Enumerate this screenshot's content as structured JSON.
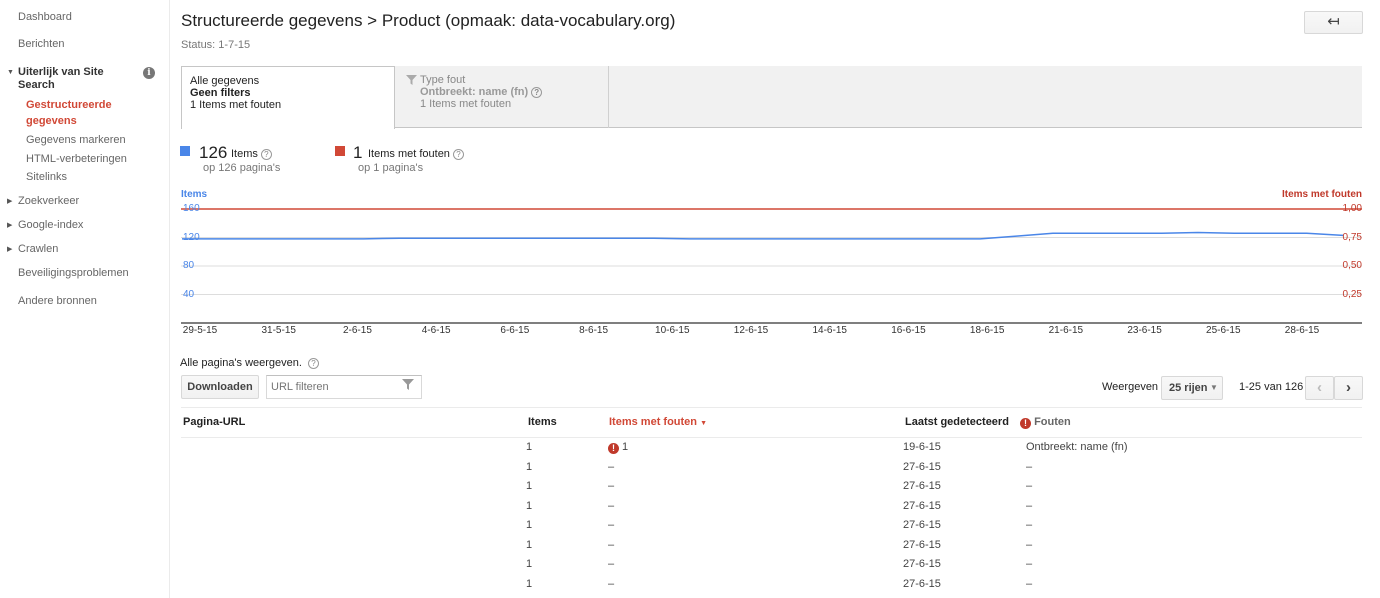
{
  "sidebar": {
    "dashboard": "Dashboard",
    "berichten": "Berichten",
    "uiterlijk": "Uiterlijk van Site Search",
    "sub": [
      "Gestructureerde gegevens",
      "Gegevens markeren",
      "HTML-verbeteringen",
      "Sitelinks"
    ],
    "zoekverkeer": "Zoekverkeer",
    "google_index": "Google-index",
    "crawlen": "Crawlen",
    "beveiliging": "Beveiligingsproblemen",
    "andere": "Andere bronnen"
  },
  "header": {
    "title": "Structureerde gegevens > Product (opmaak: data-vocabulary.org)",
    "status": "Status: 1-7-15",
    "back_glyph": "↤"
  },
  "tabs": {
    "active": {
      "line1": "Alle gegevens",
      "line2": "Geen filters",
      "line3": "1 Items met fouten"
    },
    "second": {
      "line1": "Type fout",
      "line2": "Ontbreekt: name (fn)",
      "line3": "1 Items met fouten"
    }
  },
  "legend": {
    "items": {
      "count": "126",
      "label": "Items",
      "sub": "op 126 pagina's",
      "color": "#4a86e8"
    },
    "errors": {
      "count": "1",
      "label": "Items met fouten",
      "sub": "op 1 pagina's",
      "color": "#d14836"
    }
  },
  "chart_data": {
    "type": "line",
    "ylabel": "Items",
    "ylabel_right": "Items met fouten",
    "y_ticks_left": [
      "160",
      "120",
      "80",
      "40"
    ],
    "y_ticks_right": [
      "1,00",
      "0,75",
      "0,50",
      "0,25"
    ],
    "ylim": [
      0,
      160
    ],
    "ylim_right": [
      0,
      1
    ],
    "x_ticks": [
      "29-5-15",
      "31-5-15",
      "2-6-15",
      "4-6-15",
      "6-6-15",
      "8-6-15",
      "10-6-15",
      "12-6-15",
      "14-6-15",
      "16-6-15",
      "18-6-15",
      "21-6-15",
      "23-6-15",
      "25-6-15",
      "28-6-15"
    ],
    "series": [
      {
        "name": "Items",
        "color": "#4a86e8",
        "values": [
          118,
          118,
          118,
          118,
          118,
          118,
          119,
          119,
          119,
          119,
          119,
          119,
          119,
          119,
          118,
          118,
          118,
          118,
          118,
          118,
          118,
          118,
          118,
          122,
          126,
          126,
          126,
          126,
          127,
          126,
          126,
          126,
          123
        ]
      },
      {
        "name": "Items met fouten",
        "color": "#d14836",
        "values": [
          1,
          1,
          1,
          1,
          1,
          1,
          1,
          1,
          1,
          1,
          1,
          1,
          1,
          1,
          1,
          1,
          1,
          1,
          1,
          1,
          1,
          1,
          1,
          1,
          1,
          1,
          1,
          1,
          1,
          1,
          1,
          1,
          1
        ]
      }
    ]
  },
  "toolbar": {
    "all_pages": "Alle pagina's weergeven.",
    "download": "Downloaden",
    "filter_placeholder": "URL filteren",
    "show": "Weergeven",
    "rows": "25 rijen",
    "range": "1-25 van 126",
    "prev": "‹",
    "next": "›"
  },
  "table": {
    "headers": {
      "url": "Pagina-URL",
      "items": "Items",
      "errors": "Items met fouten",
      "last": "Laatst gedetecteerd",
      "faults": "Fouten"
    },
    "rows": [
      {
        "items": "1",
        "errors": "1",
        "last": "19-6-15",
        "faults": "Ontbreekt: name (fn)"
      },
      {
        "items": "1",
        "errors": "–",
        "last": "27-6-15",
        "faults": "–"
      },
      {
        "items": "1",
        "errors": "–",
        "last": "27-6-15",
        "faults": "–"
      },
      {
        "items": "1",
        "errors": "–",
        "last": "27-6-15",
        "faults": "–"
      },
      {
        "items": "1",
        "errors": "–",
        "last": "27-6-15",
        "faults": "–"
      },
      {
        "items": "1",
        "errors": "–",
        "last": "27-6-15",
        "faults": "–"
      },
      {
        "items": "1",
        "errors": "–",
        "last": "27-6-15",
        "faults": "–"
      },
      {
        "items": "1",
        "errors": "–",
        "last": "27-6-15",
        "faults": "–"
      }
    ]
  }
}
